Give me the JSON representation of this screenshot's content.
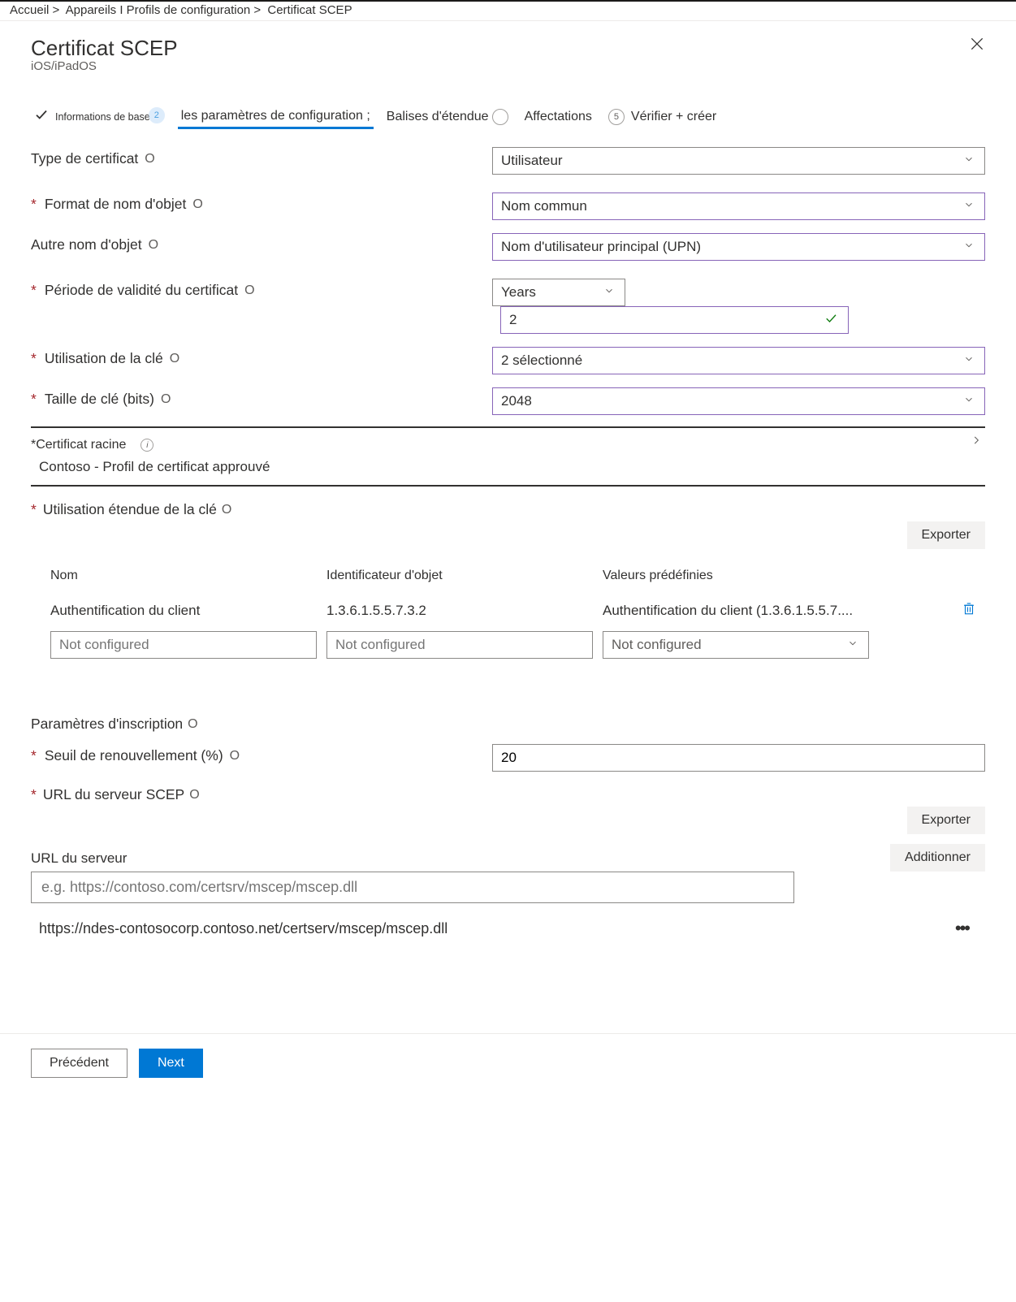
{
  "breadcrumb": {
    "home": "Accueil >",
    "devices": "Appareils I Profils de configuration >",
    "current": "Certificat SCEP"
  },
  "header": {
    "title": "Certificat SCEP",
    "subtitle": "iOS/iPadOS"
  },
  "steps": {
    "basics": "Informations de base",
    "config": "les paramètres de configuration ;",
    "scope": "Balises d'étendue",
    "assign": "Affectations",
    "review_num": "5",
    "review": "Vérifier + créer"
  },
  "fields": {
    "certType": {
      "label": "Type de certificat",
      "info": "O",
      "value": "Utilisateur"
    },
    "subjectFormat": {
      "label": "Format de nom d'objet",
      "info": "O",
      "value": "Nom commun"
    },
    "san": {
      "label": "Autre nom d'objet",
      "info": "O",
      "value": "Nom d'utilisateur principal (UPN)"
    },
    "validity": {
      "label": "Période de validité du certificat",
      "info": "O",
      "unit": "Years",
      "value": "2"
    },
    "keyUsage": {
      "label": "Utilisation de la clé",
      "info": "O",
      "value": "2 sélectionné"
    },
    "keySize": {
      "label": "Taille de clé (bits)",
      "info": "O",
      "value": "2048"
    },
    "rootCert": {
      "label": "*Certificat racine",
      "value": "Contoso - Profil de certificat approuvé"
    },
    "eku": {
      "label": "Utilisation étendue de la clé",
      "info": "O"
    },
    "export": "Exporter",
    "ekuTable": {
      "h1": "Nom",
      "h2": "Identificateur d'objet",
      "h3": "Valeurs prédéfinies",
      "r1c1": "Authentification du client",
      "r1c2": "1.3.6.1.5.5.7.3.2",
      "r1c3": "Authentification du client (1.3.6.1.5.5.7....",
      "placeholder": "Not configured"
    },
    "enroll": {
      "label": "Paramètres d'inscription",
      "info": "O"
    },
    "renewal": {
      "label": "Seuil de renouvellement (%)",
      "info": "O",
      "value": "20"
    },
    "scepUrl": {
      "label": "URL du serveur SCEP",
      "info": "O"
    },
    "serverUrlLabel": "URL du serveur",
    "serverUrlPlaceholder": "e.g. https://contoso.com/certsrv/mscep/mscep.dll",
    "add": "Additionner",
    "urlItem": "https://ndes-contosocorp.contoso.net/certserv/mscep/mscep.dll"
  },
  "footer": {
    "prev": "Précédent",
    "next": "Next"
  }
}
